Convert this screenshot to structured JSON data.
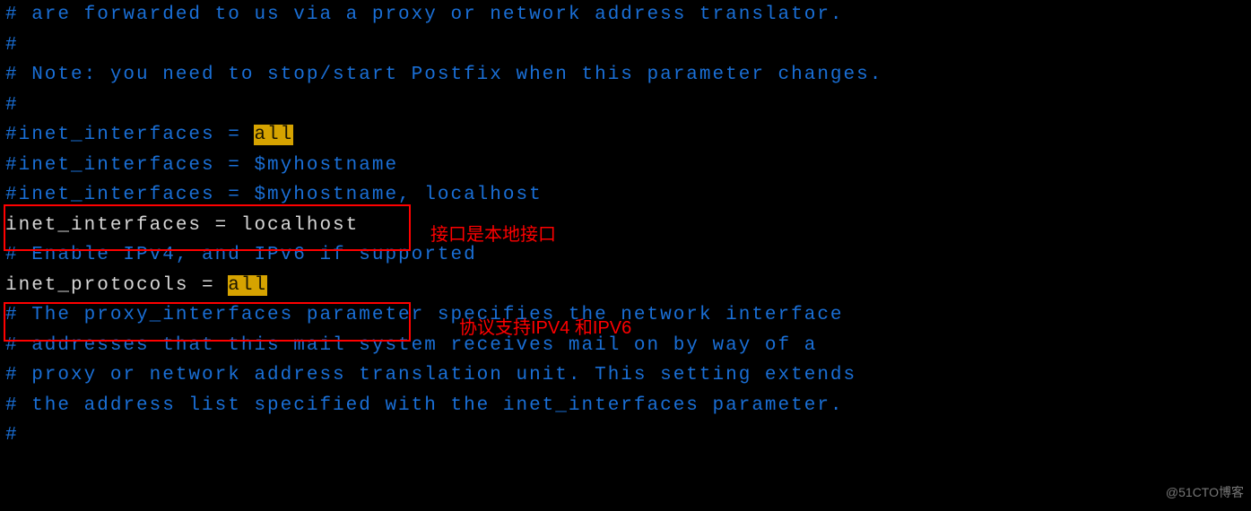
{
  "lines": {
    "l1": "# are forwarded to us via a proxy or network address translator.",
    "l2": "#",
    "l3": "# Note: you need to stop/start Postfix when this parameter changes.",
    "l4": "#",
    "l5a": "#inet_interfaces = ",
    "l5b": "all",
    "l6": "#inet_interfaces = $myhostname",
    "l7": "#inet_interfaces = $myhostname, localhost",
    "l8": "inet_interfaces = localhost",
    "l9": "",
    "l10": "# Enable IPv4, and IPv6 if supported",
    "l11a": "inet_protocols = ",
    "l11b": "all",
    "l12": "",
    "l13": "# The proxy_interfaces parameter specifies the network interface",
    "l14": "# addresses that this mail system receives mail on by way of a",
    "l15": "# proxy or network address translation unit. This setting extends",
    "l16": "# the address list specified with the inet_interfaces parameter.",
    "l17": "#"
  },
  "annotations": {
    "a1": "接口是本地接口",
    "a2": "协议支持IPV4 和IPV6"
  },
  "watermark": "@51CTO博客"
}
